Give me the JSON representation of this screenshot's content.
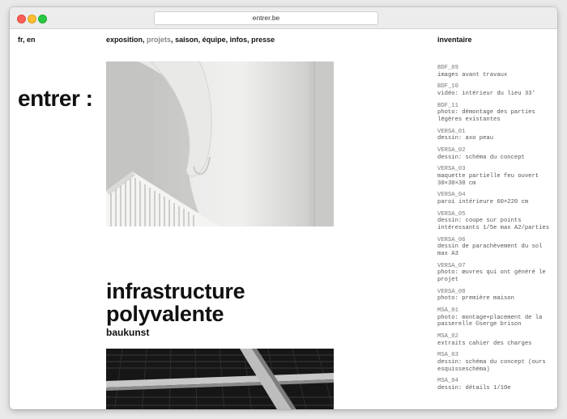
{
  "browser": {
    "url": "entrer.be"
  },
  "header": {
    "languages": "fr, en",
    "nav": [
      {
        "label": "exposition",
        "active": false
      },
      {
        "label": "projets",
        "active": true
      },
      {
        "label": "saison",
        "active": false
      },
      {
        "label": "équipe",
        "active": false
      },
      {
        "label": "infos",
        "active": false
      },
      {
        "label": "presse",
        "active": false
      }
    ],
    "inventory_title": "inventaire"
  },
  "logo": "entrer",
  "project": {
    "title_line1": "infrastructure",
    "title_line2": "polyvalente",
    "subtitle": "baukunst"
  },
  "inventory": [
    {
      "code": "BDF_09",
      "text": "images avant travaux"
    },
    {
      "code": "BDF_10",
      "text": "vidéo: intérieur du lieu 33'"
    },
    {
      "code": "BDF_11",
      "text": "photo: démontage des parties légères existantes"
    },
    {
      "code": "VERSA_01",
      "text": "dessin: axo peau"
    },
    {
      "code": "VERSA_02",
      "text": "dessin: schéma du concept"
    },
    {
      "code": "VERSA_03",
      "text": "maquette partielle feu ouvert 30×30×30 cm"
    },
    {
      "code": "VERSA_04",
      "text": "paroi intérieure 60×220 cm"
    },
    {
      "code": "VERSA_05",
      "text": "dessin: coupe sur points intéressants 1/5e max A2/parties"
    },
    {
      "code": "VERSA_06",
      "text": "dessin de parachèvement du sol max A3"
    },
    {
      "code": "VERSA_07",
      "text": "photo: œuvres qui ont généré le projet"
    },
    {
      "code": "VERSA_08",
      "text": "photo: première maison"
    },
    {
      "code": "MSA_01",
      "text": "photo: montage+placement de la passerelle ©serge brison"
    },
    {
      "code": "MSA_02",
      "text": "extraits cahier des charges"
    },
    {
      "code": "MSA_03",
      "text": "dessin: schéma du concept (ours esquisseschéma)"
    },
    {
      "code": "MSA_04",
      "text": "dessin: détails 1/10e"
    }
  ]
}
